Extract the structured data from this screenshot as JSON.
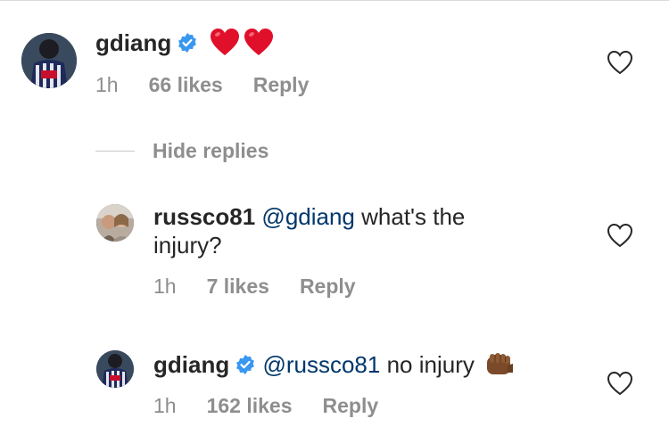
{
  "comments": [
    {
      "username": "gdiang",
      "verified": true,
      "mention": "",
      "text": "",
      "emoji": "red-heart x2",
      "time": "1h",
      "likes": "66 likes",
      "reply": "Reply"
    }
  ],
  "hide_replies": "Hide replies",
  "replies": [
    {
      "username": "russco81",
      "verified": false,
      "mention": "@gdiang",
      "text_line1": " what's the",
      "text_line2": "injury?",
      "time": "1h",
      "likes": "7 likes",
      "reply": "Reply"
    },
    {
      "username": "gdiang",
      "verified": true,
      "mention": "@russco81",
      "text": " no injury",
      "emoji": "oncoming-fist-dark-skin",
      "time": "1h",
      "likes": "162 likes",
      "reply": "Reply"
    }
  ],
  "colors": {
    "verified_badge": "#3897f0",
    "heart_emoji": "#e0102b",
    "mention": "#00376b",
    "meta_text": "#8e8e8e"
  }
}
